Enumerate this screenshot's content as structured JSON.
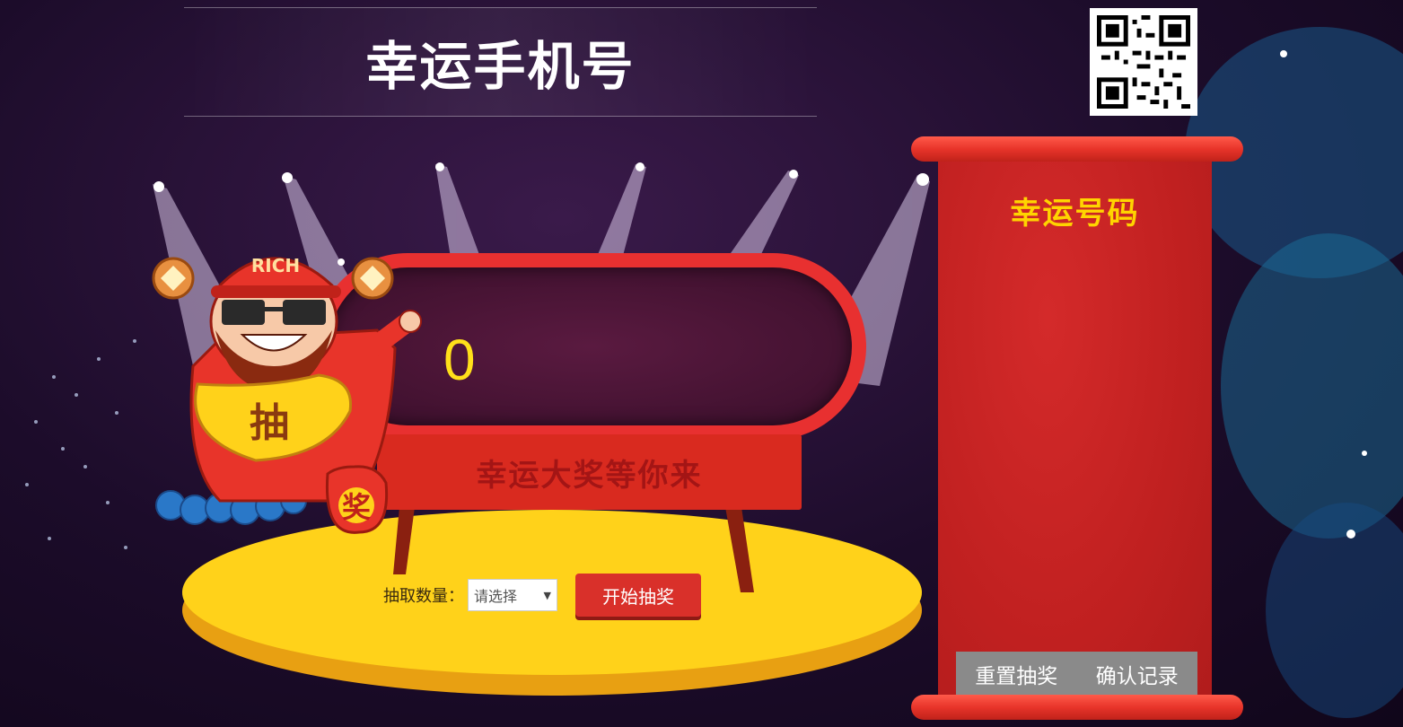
{
  "page": {
    "title": "幸运手机号"
  },
  "qr": {
    "icon": "qr-code-icon"
  },
  "lottery": {
    "display_value": "0",
    "sign_text": "幸运大奖等你来",
    "mascot_hat_text": "RICH",
    "mascot_ingot_text": "抽",
    "mascot_bag_text": "奖"
  },
  "controls": {
    "quantity_label": "抽取数量：",
    "quantity_select_value": "请选择",
    "start_button": "开始抽奖"
  },
  "lucky_panel": {
    "title": "幸运号码",
    "numbers": [],
    "reset_button": "重置抽奖",
    "confirm_button": "确认记录"
  },
  "colors": {
    "accent_red": "#d9302a",
    "gold": "#ffd400",
    "stage_yellow": "#ffd21a",
    "panel_red": "#c02020",
    "button_gray": "#8a8a8a"
  }
}
